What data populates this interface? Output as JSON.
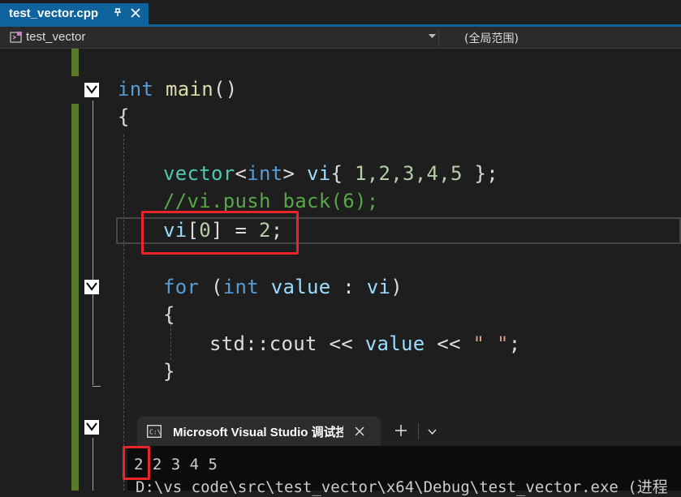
{
  "tab": {
    "filename": "test_vector.cpp"
  },
  "navbar": {
    "project": "test_vector",
    "scope": "(全局范围)"
  },
  "code": {
    "l1_kw": "int",
    "l1_fn": "main",
    "l1_paren": "()",
    "l2": "{",
    "l4_type": "vector",
    "l4_lt": "<",
    "l4_kw": "int",
    "l4_gt": ">",
    "l4_var": "vi",
    "l4_brace_open": "{ ",
    "l4_nums": "1,2,3,4,5",
    "l4_brace_close": " };",
    "l5_comment": "//vi.push_back(6);",
    "l6_var": "vi",
    "l6_idx_open": "[",
    "l6_idx": "0",
    "l6_idx_close": "]",
    "l6_eq": " = ",
    "l6_val": "2",
    "l6_semi": ";",
    "l8_for": "for",
    "l8_open": " (",
    "l8_int": "int",
    "l8_value": " value",
    "l8_colon": " : ",
    "l8_vi": "vi",
    "l8_close": ")",
    "l9": "{",
    "l10_std": "std::cout",
    "l10_op1": " << ",
    "l10_value": "value",
    "l10_op2": " << ",
    "l10_str": "\" \"",
    "l10_semi": ";",
    "l11": "}"
  },
  "console": {
    "title": "Microsoft Visual Studio 调试控制台",
    "output": "2 2 3 4 5",
    "path": "D:\\vs code\\src\\test_vector\\x64\\Debug\\test_vector.exe (进程"
  }
}
